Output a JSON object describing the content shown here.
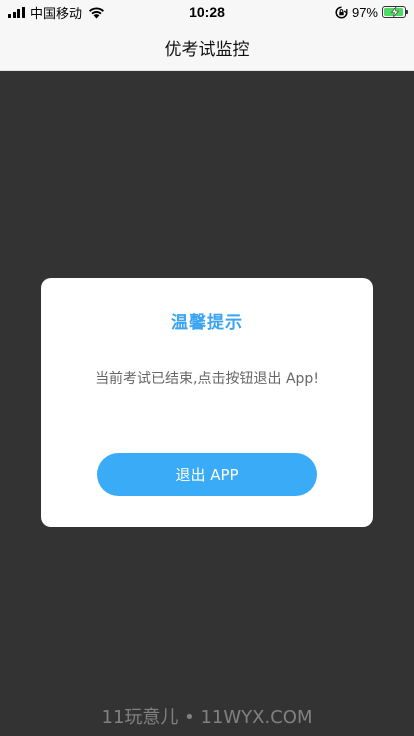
{
  "status_bar": {
    "carrier": "中国移动",
    "time": "10:28",
    "battery_percent": "97%",
    "battery_level": 0.97,
    "icons": [
      "signal-icon",
      "wifi-icon",
      "rotation-lock-icon",
      "battery-charging-icon"
    ]
  },
  "nav": {
    "title": "优考试监控"
  },
  "dialog": {
    "title": "温馨提示",
    "message": "当前考试已结束,点击按钮退出 App!",
    "button_label": "退出 APP"
  },
  "watermark": {
    "text": "11玩意儿 • 11WYX.COM"
  },
  "colors": {
    "accent": "#3aabf7",
    "title_blue": "#3aa4f0",
    "overlay": "#333333",
    "battery_green": "#4cd964"
  }
}
